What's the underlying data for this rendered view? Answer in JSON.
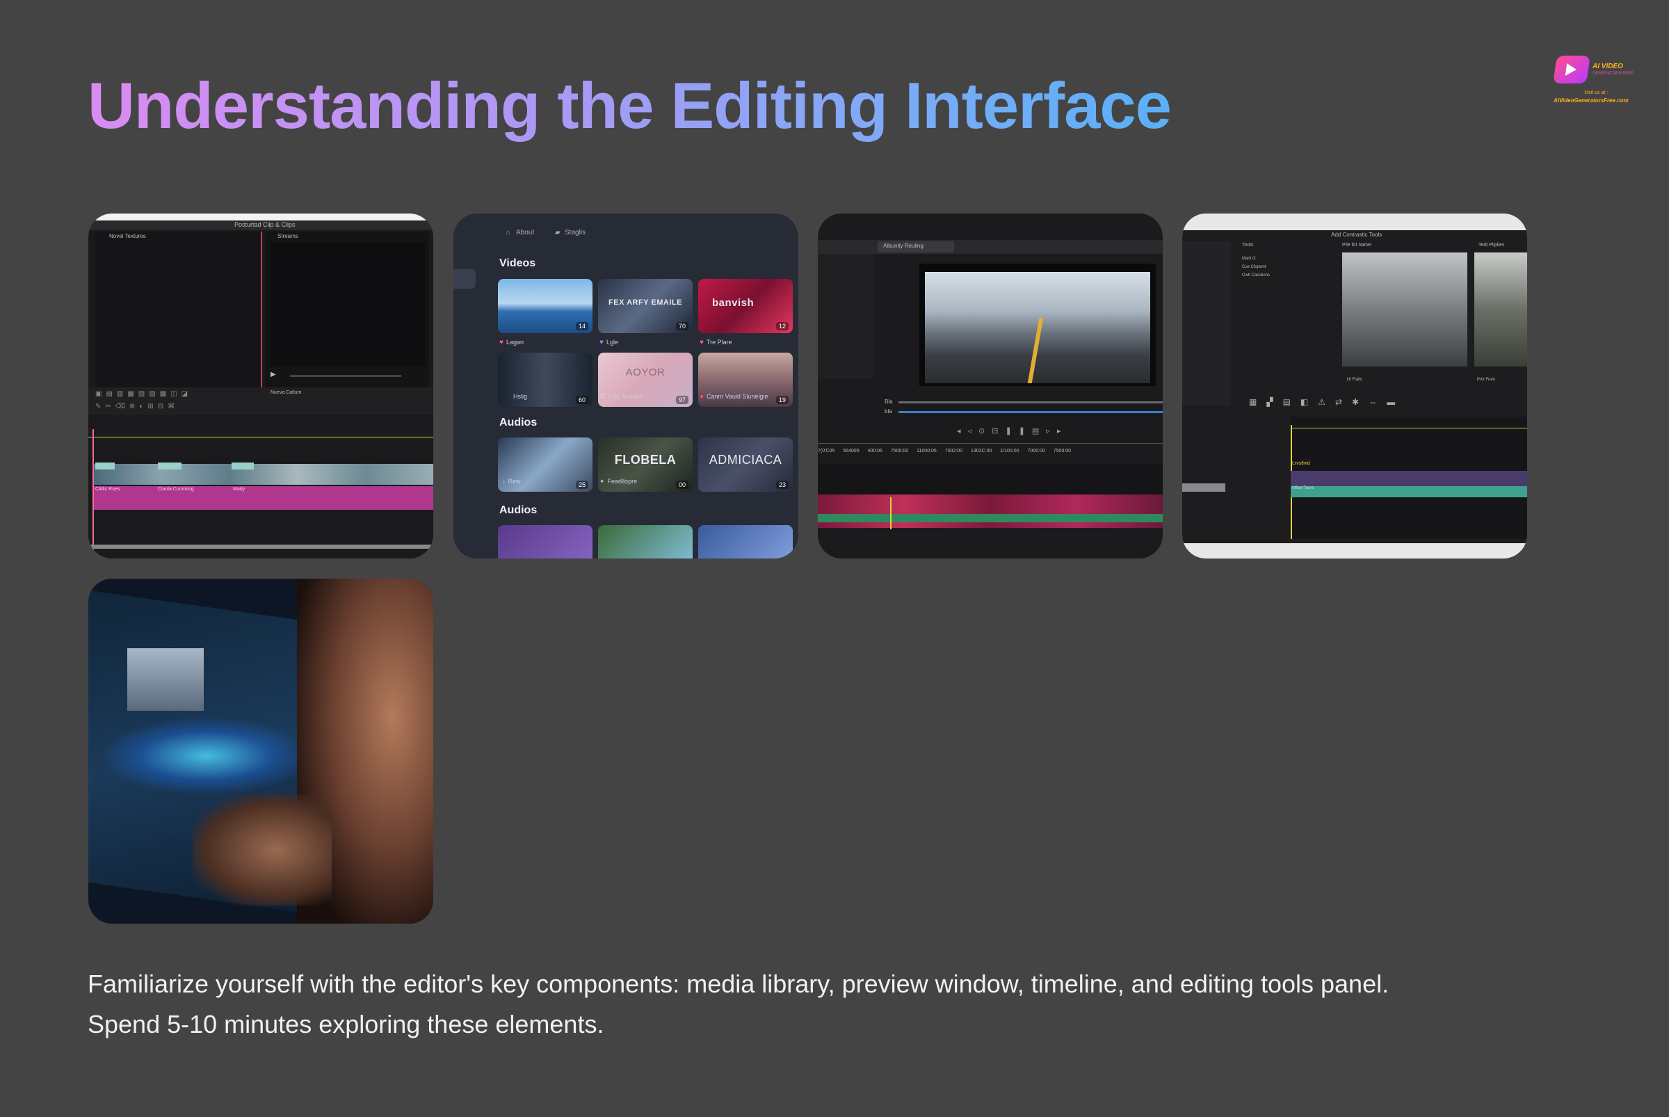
{
  "header": {
    "title": "Understanding the Editing Interface"
  },
  "logo": {
    "line1": "AI VIDEO",
    "line2": "GENERATORS FREE",
    "line3": "Visit us at :",
    "line4": "AIVideoGeneratorsFree.com"
  },
  "screens": {
    "timeline_editor": {
      "window_title": "Posturtad Clip & Clips",
      "panel_left": "Novel Textures",
      "panel_right": "Streams",
      "tool_label": "Nueva Catlum",
      "clip_labels": [
        "Clidic Rues",
        "Ciaola Cumming",
        "Mady"
      ]
    },
    "media_library": {
      "nav": [
        "About",
        "Staglis"
      ],
      "sections": [
        "Videos",
        "Audios",
        "Audios"
      ],
      "video_row1": [
        {
          "caption": "Lagan",
          "count": "14"
        },
        {
          "caption": "Lgle",
          "count": "70",
          "overlay": "FEX ARFY EMAILE"
        },
        {
          "caption": "Tre Plare",
          "count": "12",
          "overlay": "banvish"
        }
      ],
      "video_row2": [
        {
          "caption": "Hslig",
          "count": "60"
        },
        {
          "caption": "Fley Austies",
          "count": "97",
          "overlay": "AOYOR"
        },
        {
          "caption": "Canm Vauld Slunelgie",
          "count": "19"
        }
      ],
      "audio_row": [
        {
          "caption": "Rew",
          "count": "25"
        },
        {
          "caption": "Feadllopre",
          "count": "00",
          "overlay": "FLOBELA"
        },
        {
          "caption": "",
          "count": "23",
          "overlay": "ADMICIACA"
        }
      ]
    },
    "preview_window": {
      "tab": "Albunity Reuling",
      "slider_labels": [
        "Bla",
        "bla"
      ],
      "timecodes": [
        "7(0'C05",
        "564005",
        "400:05",
        "7500:00",
        "11000:05",
        "7002:00",
        "1302C:00",
        "1/100:00",
        "7000:00",
        "7500:00"
      ]
    },
    "tools_panel": {
      "window_title": "Add Contrastic Tools",
      "col1": "Tools",
      "col2": "Pile fot Sarter",
      "col3": "Tedt Pliplies",
      "items": [
        "Mant G",
        "Cue Clopwnt",
        "Cwh Caculions"
      ],
      "footer": [
        "16 Flatis",
        "Prtit Fuen"
      ],
      "track_label": "Lrvstlvid",
      "track2": "Irffuel Tuors"
    },
    "person_photo": {}
  },
  "description": {
    "line1": "Familiarize yourself with the editor's key components: media library, preview window, timeline, and editing tools panel.",
    "line2": "Spend 5-10 minutes exploring these elements."
  }
}
